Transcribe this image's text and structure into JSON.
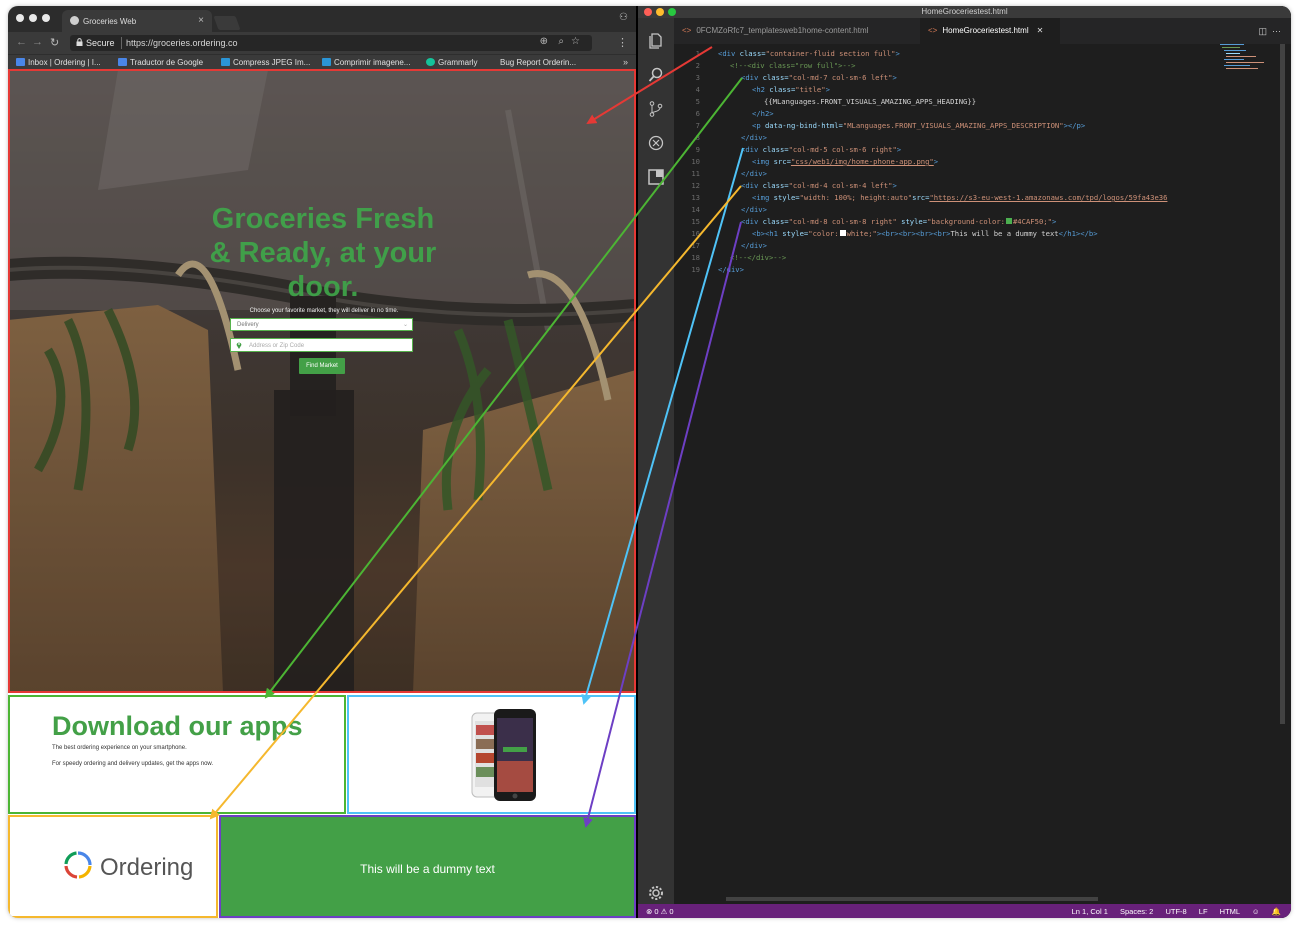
{
  "browser": {
    "tab_title": "Groceries Web",
    "secure_label": "Secure",
    "url": "https://groceries.ordering.co",
    "bookmarks": [
      {
        "label": "Inbox | Ordering | I...",
        "color": "#4a86e8"
      },
      {
        "label": "Traductor de Google",
        "color": "#4a86e8"
      },
      {
        "label": "Compress JPEG Im...",
        "color": "#2b95d6"
      },
      {
        "label": "Comprimir imagene...",
        "color": "#2b95d6"
      },
      {
        "label": "Grammarly",
        "color": "#15c39a"
      },
      {
        "label": "Bug Report Orderin...",
        "color": "#777777"
      }
    ],
    "bookmarks_overflow": "»"
  },
  "hero": {
    "title": "Groceries Fresh & Ready, at your door.",
    "subtitle": "Choose your favorite market, they will deliver in no time.",
    "delivery_select": "Delivery",
    "address_placeholder": "Address or Zip Code",
    "find_button": "Find Market"
  },
  "download": {
    "title": "Download our apps",
    "line1": "The best ordering experience on your smartphone.",
    "line2": "For speedy ordering and delivery updates, get the apps now."
  },
  "logo": {
    "text": "Ordering"
  },
  "green": {
    "text": "This will be a dummy text",
    "color": "#43a047"
  },
  "editor": {
    "window_title": "HomeGroceriestest.html",
    "tabs": [
      {
        "label": "0FCMZoRfc7_templatesweb1home-content.html",
        "active": false
      },
      {
        "label": "HomeGroceriestest.html",
        "active": true
      }
    ],
    "line_numbers": [
      "1",
      "2",
      "3",
      "4",
      "5",
      "6",
      "7",
      "8",
      "9",
      "10",
      "11",
      "12",
      "13",
      "14",
      "15",
      "16",
      "17",
      "18",
      "19"
    ],
    "code": {
      "l1": {
        "tag_open": "<div",
        "attr": " class=",
        "val": "\"container-fluid section full\"",
        "close": ">"
      },
      "l2": "<!--<div class=\"row full\">-->",
      "l3": {
        "tag_open": "<div",
        "attr": " class=",
        "val": "\"col-md-7 col-sm-6 left\"",
        "close": ">"
      },
      "l4": {
        "tag_open": "<h2",
        "attr": " class=",
        "val": "\"title\"",
        "close": ">"
      },
      "l5": "{{MLanguages.FRONT_VISUALS_AMAZING_APPS_HEADING}}",
      "l6": "</h2>",
      "l7": {
        "tag_open": "<p",
        "attr": " data-ng-bind-html=",
        "val": "\"MLanguages.FRONT_VISUALS_AMAZING_APPS_DESCRIPTION\"",
        "close": "></p>"
      },
      "l8": "</div>",
      "l9": {
        "tag_open": "<div",
        "attr": " class=",
        "val": "\"col-md-5 col-sm-6 right\"",
        "close": ">"
      },
      "l10": {
        "tag_open": "<img",
        "attr": " src=",
        "val": "\"css/web1/img/home-phone-app.png\"",
        "close": ">"
      },
      "l11": "</div>",
      "l12": {
        "tag_open": "<div",
        "attr": " class=",
        "val": "\"col-md-4 col-sm-4 left\"",
        "close": ">"
      },
      "l13": {
        "tag_open": "<img",
        "attr": " style=",
        "val": "\"width: 100%; height:auto\"",
        "attr2": "src=",
        "val2": "\"https://s3-eu-west-1.amazonaws.com/tpd/logos/59fa43e36"
      },
      "l14": "</div>",
      "l15": {
        "tag_open": "<div",
        "attr": " class=",
        "val": "\"col-md-8 col-sm-8 right\"",
        "attr2": " style=",
        "val2": "\"background-color:",
        "val3": "#4CAF50;\"",
        "close": ">"
      },
      "l16": {
        "pre": "<b><h1",
        "attr": " style=",
        "val": "\"color:",
        "val2": "white;\"",
        "mid": "><br><br><br><br>",
        "text": "This will be a dummy text",
        "end": "</h1></b>"
      },
      "l17": "</div>",
      "l18": "<!--</div>-->",
      "l19": "</div>"
    },
    "status": {
      "problems": "⊗ 0 ⚠ 0",
      "position": "Ln 1, Col 1",
      "spaces": "Spaces: 2",
      "encoding": "UTF-8",
      "eol": "LF",
      "language": "HTML"
    },
    "status_color": "#68217a"
  },
  "outline_colors": {
    "hero": "#e53935",
    "download": "#4cb534",
    "phone": "#4fc3f7",
    "logo": "#f5b82e",
    "green": "#6d3fc4"
  }
}
